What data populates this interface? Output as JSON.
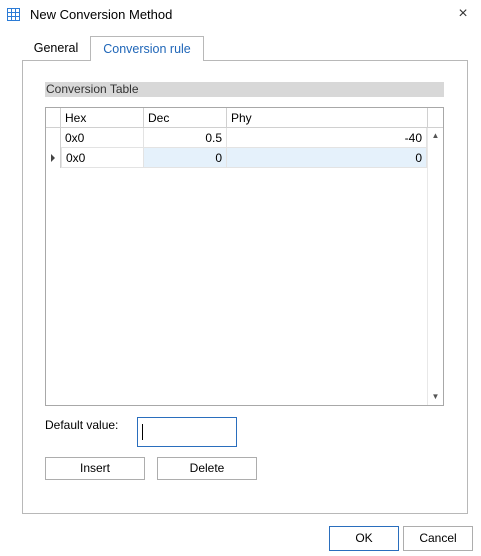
{
  "window": {
    "title": "New Conversion Method",
    "close_glyph": "×",
    "icon": "grid-table-icon"
  },
  "tabs": [
    {
      "label": "General",
      "active": false
    },
    {
      "label": "Conversion rule",
      "active": true
    }
  ],
  "conversion_table": {
    "caption": "Conversion Table",
    "columns": [
      "Hex",
      "Dec",
      "Phy"
    ],
    "rows": [
      {
        "hex": "0x0",
        "dec": "0.5",
        "phy": "-40",
        "selected": false
      },
      {
        "hex": "0x0",
        "dec": "0",
        "phy": "0",
        "selected": true
      }
    ],
    "scroll_up_glyph": "▲",
    "scroll_down_glyph": "▼"
  },
  "default_value": {
    "label": "Default value:",
    "value": ""
  },
  "buttons": {
    "insert": "Insert",
    "delete": "Delete",
    "ok": "OK",
    "cancel": "Cancel"
  },
  "colors": {
    "accent": "#2a6ebd",
    "active_tab_text": "#1f66b8",
    "selected_row": "#e5f1fb",
    "caption_bg": "#d8d8d8"
  }
}
